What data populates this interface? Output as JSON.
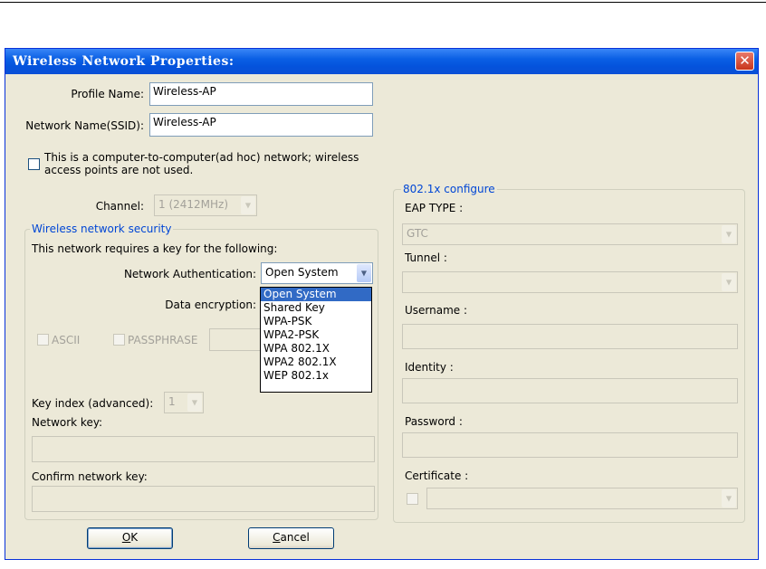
{
  "window": {
    "title": "Wireless Network Properties:",
    "close_symbol": "✕"
  },
  "profile": {
    "label": "Profile Name:",
    "value": "Wireless-AP"
  },
  "ssid": {
    "label": "Network Name(SSID):",
    "value": "Wireless-AP"
  },
  "adhoc": {
    "label_line1": "This is a computer-to-computer(ad hoc) network; wireless",
    "label_line2": "access points are not used.",
    "checked": false
  },
  "channel": {
    "label": "Channel:",
    "value": "1  (2412MHz)"
  },
  "security": {
    "group_title": "Wireless network security",
    "intro": "This network requires a key for the following:",
    "auth_label": "Network Authentication:",
    "auth_value": "Open System",
    "auth_options": [
      "Open System",
      "Shared Key",
      "WPA-PSK",
      "WPA2-PSK",
      "WPA 802.1X",
      "WPA2 802.1X",
      "WEP 802.1x"
    ],
    "encryption_label": "Data encryption:",
    "ascii_label": "ASCII",
    "passphrase_label": "PASSPHRASE",
    "key_index_label": "Key index (advanced):",
    "key_index_value": "1",
    "network_key_label": "Network key:",
    "confirm_key_label": "Confirm network key:"
  },
  "dot1x": {
    "group_title": "802.1x configure",
    "eap_type_label": "EAP TYPE :",
    "eap_type_value": "GTC",
    "tunnel_label": "Tunnel :",
    "username_label": "Username :",
    "identity_label": "Identity :",
    "password_label": "Password :",
    "certificate_label": "Certificate :"
  },
  "buttons": {
    "ok_mnemonic": "O",
    "ok_rest": "K",
    "cancel_mnemonic": "C",
    "cancel_rest": "ancel"
  },
  "icons": {
    "dropdown_arrow": "▼"
  }
}
